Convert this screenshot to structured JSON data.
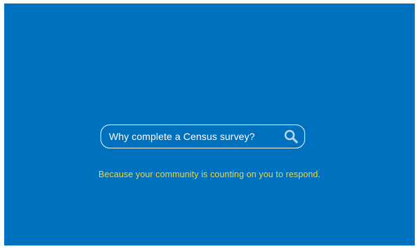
{
  "slide": {
    "background_color": "#0071bf",
    "search": {
      "query": "Why complete a Census survey?",
      "icon": "search-icon",
      "border_color": "#f4f8fc",
      "text_color": "#ffffff"
    },
    "answer": {
      "text": "Because your community is counting on you to respond.",
      "color": "#f4d533"
    }
  }
}
